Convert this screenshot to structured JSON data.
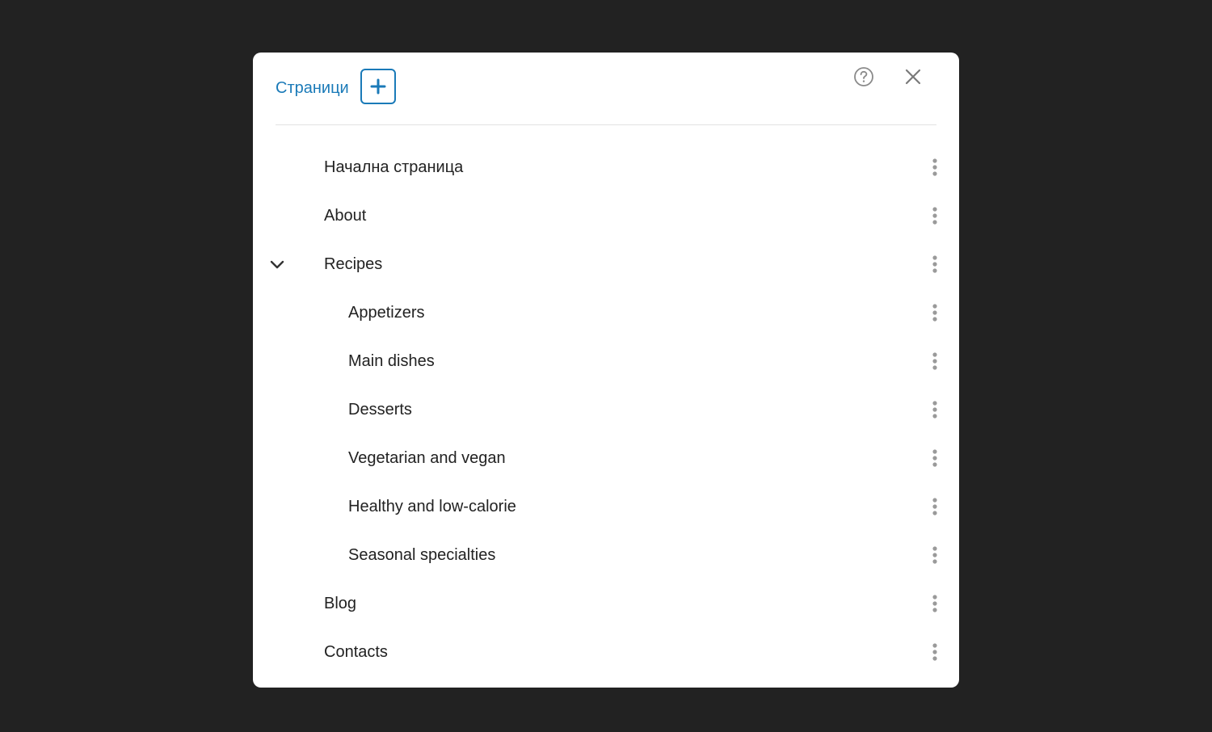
{
  "dialog": {
    "title": "Страници",
    "accent_color": "#1a7ab8",
    "icons": {
      "add": "plus-icon",
      "help": "question-circle-icon",
      "close": "close-icon",
      "expand": "chevron-down-icon",
      "more": "kebab-menu-icon"
    }
  },
  "pages": [
    {
      "label": "Начална страница",
      "level": 0,
      "expanded": null
    },
    {
      "label": "About",
      "level": 0,
      "expanded": null
    },
    {
      "label": "Recipes",
      "level": 0,
      "expanded": true
    },
    {
      "label": "Appetizers",
      "level": 1,
      "expanded": null
    },
    {
      "label": "Main dishes",
      "level": 1,
      "expanded": null
    },
    {
      "label": "Desserts",
      "level": 1,
      "expanded": null
    },
    {
      "label": "Vegetarian and vegan",
      "level": 1,
      "expanded": null
    },
    {
      "label": "Healthy and low-calorie",
      "level": 1,
      "expanded": null
    },
    {
      "label": "Seasonal specialties",
      "level": 1,
      "expanded": null
    },
    {
      "label": "Blog",
      "level": 0,
      "expanded": null
    },
    {
      "label": "Contacts",
      "level": 0,
      "expanded": null
    }
  ]
}
